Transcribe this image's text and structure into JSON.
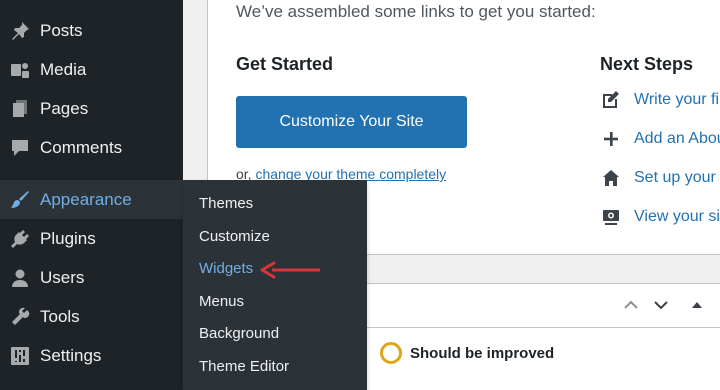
{
  "sidebar": {
    "items": [
      {
        "label": "Posts",
        "icon": "pushpin-icon"
      },
      {
        "label": "Media",
        "icon": "media-icon"
      },
      {
        "label": "Pages",
        "icon": "pages-icon"
      },
      {
        "label": "Comments",
        "icon": "comment-icon"
      },
      {
        "label": "Appearance",
        "icon": "paintbrush-icon",
        "current": true
      },
      {
        "label": "Plugins",
        "icon": "plug-icon"
      },
      {
        "label": "Users",
        "icon": "user-icon"
      },
      {
        "label": "Tools",
        "icon": "wrench-icon"
      },
      {
        "label": "Settings",
        "icon": "settings-icon"
      }
    ]
  },
  "flyout": {
    "items": [
      {
        "label": "Themes"
      },
      {
        "label": "Customize"
      },
      {
        "label": "Widgets",
        "active": true
      },
      {
        "label": "Menus"
      },
      {
        "label": "Background"
      },
      {
        "label": "Theme Editor"
      }
    ]
  },
  "welcome": {
    "intro": "We’ve assembled some links to get you started:",
    "get_started_title": "Get Started",
    "customize_button": "Customize Your Site",
    "or_prefix": "or, ",
    "change_theme_link": "change your theme completely",
    "next_steps_title": "Next Steps",
    "next_steps": [
      {
        "label": "Write your fi",
        "icon": "edit-icon"
      },
      {
        "label": "Add an Abou",
        "icon": "plus-icon"
      },
      {
        "label": "Set up your",
        "icon": "home-icon"
      },
      {
        "label": "View your si",
        "icon": "view-icon"
      }
    ]
  },
  "site_health": {
    "status": "Should be improved"
  },
  "colors": {
    "sidebar_bg": "#1d2327",
    "accent": "#2271b1",
    "highlight": "#72aee6",
    "annotation_arrow": "#d63638",
    "status_ring": "#dba617"
  }
}
